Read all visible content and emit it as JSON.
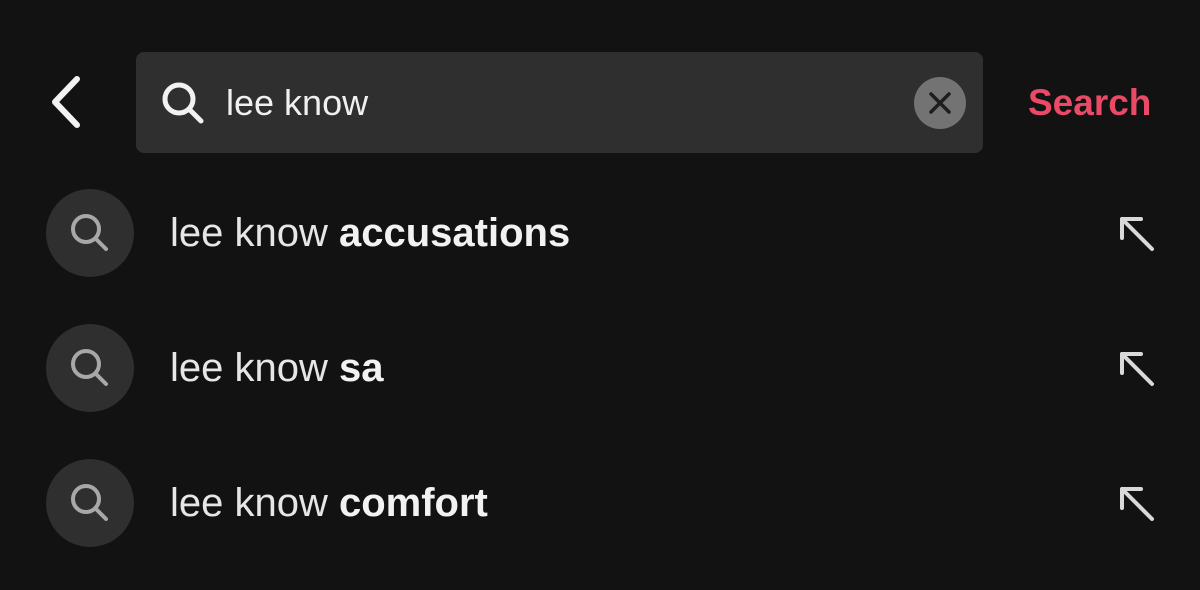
{
  "header": {
    "back_icon": "chevron-left-icon",
    "search_icon": "search-icon",
    "search_value": "lee know",
    "clear_icon": "close-icon",
    "submit_label": "Search",
    "submit_color": "#ea4a66"
  },
  "suggestions": [
    {
      "prefix": "lee know ",
      "completion": "accusations",
      "icon": "search-icon",
      "action_icon": "arrow-up-left-icon"
    },
    {
      "prefix": "lee know ",
      "completion": "sa",
      "icon": "search-icon",
      "action_icon": "arrow-up-left-icon"
    },
    {
      "prefix": "lee know ",
      "completion": "comfort",
      "icon": "search-icon",
      "action_icon": "arrow-up-left-icon"
    }
  ],
  "colors": {
    "background": "#121212",
    "field": "#2f2f2f",
    "accent": "#ea4a66"
  }
}
